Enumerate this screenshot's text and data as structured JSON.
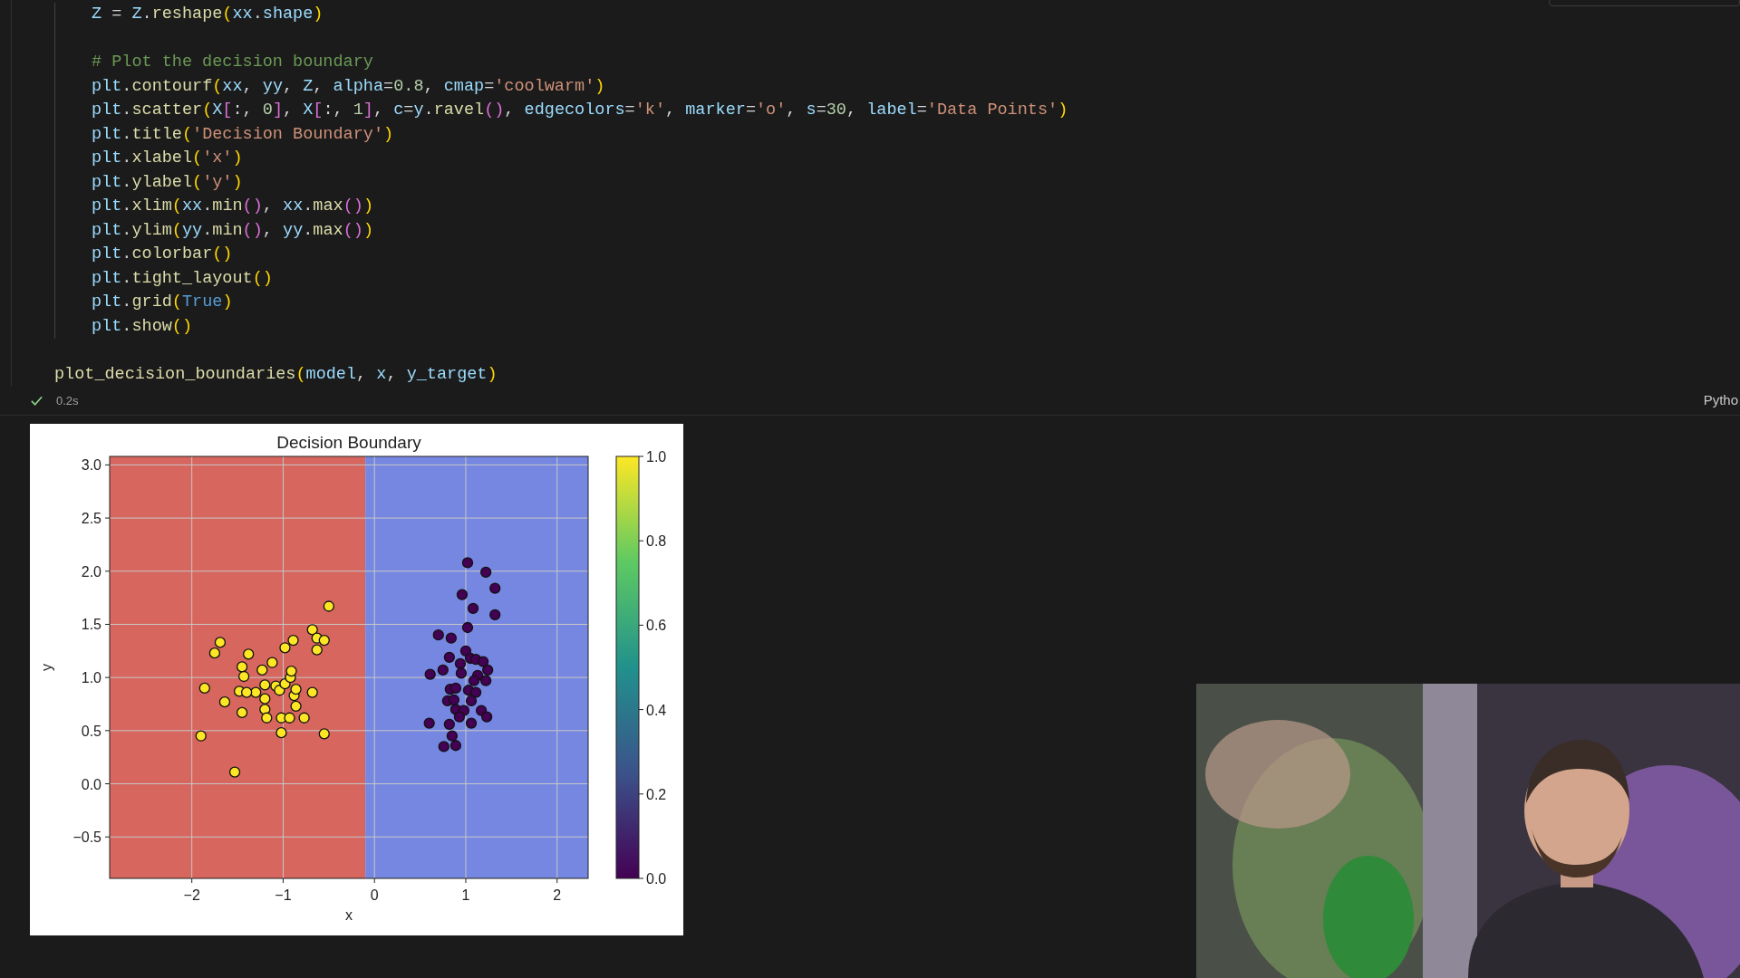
{
  "function_body": {
    "blocks": [
      [
        {
          "tokens": [
            {
              "t": "Z",
              "kind": "var"
            },
            {
              "t": " = ",
              "kind": "plain"
            },
            {
              "t": "Z",
              "kind": "var"
            },
            {
              "t": ".",
              "kind": "plain"
            },
            {
              "t": "reshape",
              "kind": "func"
            },
            {
              "t": "(",
              "kind": "b1"
            },
            {
              "t": "xx",
              "kind": "var"
            },
            {
              "t": ".",
              "kind": "plain"
            },
            {
              "t": "shape",
              "kind": "var"
            },
            {
              "t": ")",
              "kind": "b1"
            }
          ]
        }
      ],
      [
        {
          "tokens": [
            {
              "t": "# Plot the decision boundary",
              "kind": "comment"
            }
          ]
        },
        {
          "tokens": [
            {
              "t": "plt",
              "kind": "var"
            },
            {
              "t": ".",
              "kind": "plain"
            },
            {
              "t": "contourf",
              "kind": "func"
            },
            {
              "t": "(",
              "kind": "b1"
            },
            {
              "t": "xx",
              "kind": "var"
            },
            {
              "t": ", ",
              "kind": "plain"
            },
            {
              "t": "yy",
              "kind": "var"
            },
            {
              "t": ", ",
              "kind": "plain"
            },
            {
              "t": "Z",
              "kind": "var"
            },
            {
              "t": ", ",
              "kind": "plain"
            },
            {
              "t": "alpha",
              "kind": "var"
            },
            {
              "t": "=",
              "kind": "plain"
            },
            {
              "t": "0.8",
              "kind": "num"
            },
            {
              "t": ", ",
              "kind": "plain"
            },
            {
              "t": "cmap",
              "kind": "var"
            },
            {
              "t": "=",
              "kind": "plain"
            },
            {
              "t": "'coolwarm'",
              "kind": "str"
            },
            {
              "t": ")",
              "kind": "b1"
            }
          ]
        },
        {
          "tokens": [
            {
              "t": "plt",
              "kind": "var"
            },
            {
              "t": ".",
              "kind": "plain"
            },
            {
              "t": "scatter",
              "kind": "func"
            },
            {
              "t": "(",
              "kind": "b1"
            },
            {
              "t": "X",
              "kind": "var"
            },
            {
              "t": "[",
              "kind": "b2"
            },
            {
              "t": ":, ",
              "kind": "plain"
            },
            {
              "t": "0",
              "kind": "num"
            },
            {
              "t": "]",
              "kind": "b2"
            },
            {
              "t": ", ",
              "kind": "plain"
            },
            {
              "t": "X",
              "kind": "var"
            },
            {
              "t": "[",
              "kind": "b2"
            },
            {
              "t": ":, ",
              "kind": "plain"
            },
            {
              "t": "1",
              "kind": "num"
            },
            {
              "t": "]",
              "kind": "b2"
            },
            {
              "t": ", ",
              "kind": "plain"
            },
            {
              "t": "c",
              "kind": "var"
            },
            {
              "t": "=",
              "kind": "plain"
            },
            {
              "t": "y",
              "kind": "var"
            },
            {
              "t": ".",
              "kind": "plain"
            },
            {
              "t": "ravel",
              "kind": "func"
            },
            {
              "t": "()",
              "kind": "b2"
            },
            {
              "t": ", ",
              "kind": "plain"
            },
            {
              "t": "edgecolors",
              "kind": "var"
            },
            {
              "t": "=",
              "kind": "plain"
            },
            {
              "t": "'k'",
              "kind": "str"
            },
            {
              "t": ", ",
              "kind": "plain"
            },
            {
              "t": "marker",
              "kind": "var"
            },
            {
              "t": "=",
              "kind": "plain"
            },
            {
              "t": "'o'",
              "kind": "str"
            },
            {
              "t": ", ",
              "kind": "plain"
            },
            {
              "t": "s",
              "kind": "var"
            },
            {
              "t": "=",
              "kind": "plain"
            },
            {
              "t": "30",
              "kind": "num"
            },
            {
              "t": ", ",
              "kind": "plain"
            },
            {
              "t": "label",
              "kind": "var"
            },
            {
              "t": "=",
              "kind": "plain"
            },
            {
              "t": "'Data Points'",
              "kind": "str"
            },
            {
              "t": ")",
              "kind": "b1"
            }
          ]
        },
        {
          "tokens": [
            {
              "t": "plt",
              "kind": "var"
            },
            {
              "t": ".",
              "kind": "plain"
            },
            {
              "t": "title",
              "kind": "func"
            },
            {
              "t": "(",
              "kind": "b1"
            },
            {
              "t": "'Decision Boundary'",
              "kind": "str"
            },
            {
              "t": ")",
              "kind": "b1"
            }
          ]
        },
        {
          "tokens": [
            {
              "t": "plt",
              "kind": "var"
            },
            {
              "t": ".",
              "kind": "plain"
            },
            {
              "t": "xlabel",
              "kind": "func"
            },
            {
              "t": "(",
              "kind": "b1"
            },
            {
              "t": "'x'",
              "kind": "str"
            },
            {
              "t": ")",
              "kind": "b1"
            }
          ]
        },
        {
          "tokens": [
            {
              "t": "plt",
              "kind": "var"
            },
            {
              "t": ".",
              "kind": "plain"
            },
            {
              "t": "ylabel",
              "kind": "func"
            },
            {
              "t": "(",
              "kind": "b1"
            },
            {
              "t": "'y'",
              "kind": "str"
            },
            {
              "t": ")",
              "kind": "b1"
            }
          ]
        },
        {
          "tokens": [
            {
              "t": "plt",
              "kind": "var"
            },
            {
              "t": ".",
              "kind": "plain"
            },
            {
              "t": "xlim",
              "kind": "func"
            },
            {
              "t": "(",
              "kind": "b1"
            },
            {
              "t": "xx",
              "kind": "var"
            },
            {
              "t": ".",
              "kind": "plain"
            },
            {
              "t": "min",
              "kind": "func"
            },
            {
              "t": "()",
              "kind": "b2"
            },
            {
              "t": ", ",
              "kind": "plain"
            },
            {
              "t": "xx",
              "kind": "var"
            },
            {
              "t": ".",
              "kind": "plain"
            },
            {
              "t": "max",
              "kind": "func"
            },
            {
              "t": "()",
              "kind": "b2"
            },
            {
              "t": ")",
              "kind": "b1"
            }
          ]
        },
        {
          "tokens": [
            {
              "t": "plt",
              "kind": "var"
            },
            {
              "t": ".",
              "kind": "plain"
            },
            {
              "t": "ylim",
              "kind": "func"
            },
            {
              "t": "(",
              "kind": "b1"
            },
            {
              "t": "yy",
              "kind": "var"
            },
            {
              "t": ".",
              "kind": "plain"
            },
            {
              "t": "min",
              "kind": "func"
            },
            {
              "t": "()",
              "kind": "b2"
            },
            {
              "t": ", ",
              "kind": "plain"
            },
            {
              "t": "yy",
              "kind": "var"
            },
            {
              "t": ".",
              "kind": "plain"
            },
            {
              "t": "max",
              "kind": "func"
            },
            {
              "t": "()",
              "kind": "b2"
            },
            {
              "t": ")",
              "kind": "b1"
            }
          ]
        },
        {
          "tokens": [
            {
              "t": "plt",
              "kind": "var"
            },
            {
              "t": ".",
              "kind": "plain"
            },
            {
              "t": "colorbar",
              "kind": "func"
            },
            {
              "t": "()",
              "kind": "b1"
            }
          ]
        },
        {
          "tokens": [
            {
              "t": "plt",
              "kind": "var"
            },
            {
              "t": ".",
              "kind": "plain"
            },
            {
              "t": "tight_layout",
              "kind": "func"
            },
            {
              "t": "()",
              "kind": "b1"
            }
          ]
        },
        {
          "tokens": [
            {
              "t": "plt",
              "kind": "var"
            },
            {
              "t": ".",
              "kind": "plain"
            },
            {
              "t": "grid",
              "kind": "func"
            },
            {
              "t": "(",
              "kind": "b1"
            },
            {
              "t": "True",
              "kind": "kw"
            },
            {
              "t": ")",
              "kind": "b1"
            }
          ]
        },
        {
          "tokens": [
            {
              "t": "plt",
              "kind": "var"
            },
            {
              "t": ".",
              "kind": "plain"
            },
            {
              "t": "show",
              "kind": "func"
            },
            {
              "t": "()",
              "kind": "b1"
            }
          ]
        }
      ]
    ]
  },
  "call_line": {
    "tokens": [
      {
        "t": "plot_decision_boundaries",
        "kind": "func"
      },
      {
        "t": "(",
        "kind": "b1"
      },
      {
        "t": "model",
        "kind": "var"
      },
      {
        "t": ", ",
        "kind": "plain"
      },
      {
        "t": "x",
        "kind": "var"
      },
      {
        "t": ", ",
        "kind": "plain"
      },
      {
        "t": "y_target",
        "kind": "var"
      },
      {
        "t": ")",
        "kind": "b1"
      }
    ]
  },
  "cell_status": {
    "succeeded": true,
    "duration": "0.2s",
    "language": "Pytho"
  },
  "output": {
    "chart_data": {
      "type": "scatter",
      "title": "Decision Boundary",
      "xlabel": "x",
      "ylabel": "y",
      "xlim": [
        -2.9,
        2.34
      ],
      "ylim": [
        -0.89,
        3.08
      ],
      "grid": true,
      "bands": [
        {
          "axis": "x",
          "from": -2.9,
          "to": -0.1,
          "color": "#d6665e"
        },
        {
          "axis": "x",
          "from": -0.1,
          "to": 2.34,
          "color": "#7587e0"
        }
      ],
      "xticks": [
        {
          "value": -2,
          "label": "−2"
        },
        {
          "value": -1,
          "label": "−1"
        },
        {
          "value": 0,
          "label": "0"
        },
        {
          "value": 1,
          "label": "1"
        },
        {
          "value": 2,
          "label": "2"
        }
      ],
      "yticks": [
        {
          "value": -0.5,
          "label": "−0.5"
        },
        {
          "value": 0,
          "label": "0.0"
        },
        {
          "value": 0.5,
          "label": "0.5"
        },
        {
          "value": 1,
          "label": "1.0"
        },
        {
          "value": 1.5,
          "label": "1.5"
        },
        {
          "value": 2,
          "label": "2.0"
        },
        {
          "value": 2.5,
          "label": "2.5"
        },
        {
          "value": 3,
          "label": "3.0"
        }
      ],
      "series": [
        {
          "color": "#fde725",
          "x": [
            -1.53,
            -1.9,
            -1.86,
            -1.75,
            -1.69,
            -1.64,
            -1.45,
            -1.45,
            -1.43,
            -1.38,
            -1.3,
            -1.23,
            -1.2,
            -1.2,
            -1.2,
            -1.18,
            -1.12,
            -1.08,
            -1.04,
            -1.02,
            -1.02,
            -0.98,
            -0.98,
            -0.93,
            -0.92,
            -0.91,
            -0.89,
            -0.88,
            -0.86,
            -0.86,
            -0.77,
            -0.68,
            -0.68,
            -0.63,
            -0.63,
            -0.55,
            -0.55,
            -0.5,
            -1.48,
            -1.4
          ],
          "values": [
            0.11,
            0.45,
            0.9,
            1.23,
            1.33,
            0.77,
            0.67,
            1.1,
            1.01,
            1.22,
            0.86,
            1.07,
            0.93,
            0.8,
            0.7,
            0.62,
            1.14,
            0.92,
            0.88,
            0.62,
            0.48,
            1.28,
            0.94,
            0.62,
            1.0,
            1.06,
            1.35,
            0.83,
            0.89,
            0.73,
            0.62,
            1.45,
            0.86,
            1.37,
            1.26,
            1.35,
            0.47,
            1.67,
            0.87,
            0.86
          ]
        },
        {
          "color": "#440154",
          "x": [
            1.02,
            1.22,
            1.32,
            0.96,
            1.08,
            1.32,
            1.02,
            0.7,
            0.84,
            0.61,
            0.75,
            0.82,
            0.94,
            1.0,
            1.05,
            1.11,
            1.19,
            1.24,
            0.95,
            1.13,
            1.09,
            1.22,
            0.83,
            0.89,
            1.03,
            1.11,
            0.8,
            0.87,
            1.06,
            0.89,
            0.98,
            1.17,
            0.6,
            0.82,
            1.06,
            0.93,
            1.23,
            0.85,
            0.76,
            0.89
          ],
          "values": [
            2.08,
            1.99,
            1.84,
            1.78,
            1.65,
            1.59,
            1.47,
            1.4,
            1.37,
            1.03,
            1.07,
            1.19,
            1.13,
            1.25,
            1.18,
            1.17,
            1.15,
            1.07,
            1.04,
            1.02,
            0.97,
            0.97,
            0.89,
            0.9,
            0.88,
            0.86,
            0.78,
            0.79,
            0.78,
            0.7,
            0.69,
            0.69,
            0.57,
            0.56,
            0.57,
            0.63,
            0.63,
            0.45,
            0.35,
            0.36
          ]
        }
      ]
    },
    "colorbar": {
      "ticks": [
        "1.0",
        "0.8",
        "0.6",
        "0.4",
        "0.2",
        "0.0"
      ]
    }
  }
}
